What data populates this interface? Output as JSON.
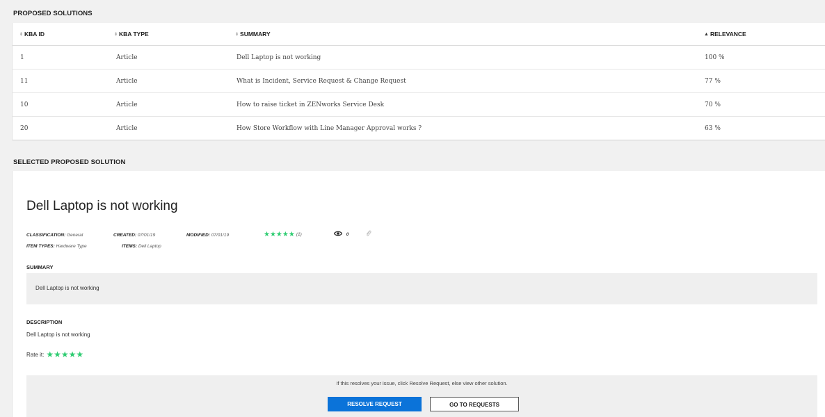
{
  "proposed_solutions": {
    "section_title": "PROPOSED SOLUTIONS",
    "columns": [
      {
        "label": "KBA ID",
        "sort": "none"
      },
      {
        "label": "KBA TYPE",
        "sort": "none"
      },
      {
        "label": "SUMMARY",
        "sort": "none"
      },
      {
        "label": "RELEVANCE",
        "sort": "ascending"
      }
    ],
    "sort_icons": {
      "none": "⇕",
      "ascending": "▲"
    },
    "rows": [
      {
        "id": "1",
        "type": "Article",
        "summary": "Dell Laptop is not working",
        "relevance": "100 %"
      },
      {
        "id": "11",
        "type": "Article",
        "summary": "What is Incident, Service Request & Change Request",
        "relevance": "77 %"
      },
      {
        "id": "10",
        "type": "Article",
        "summary": "How to raise ticket in ZENworks Service Desk",
        "relevance": "70 %"
      },
      {
        "id": "20",
        "type": "Article",
        "summary": "How Store Workflow with Line Manager Approval works ?",
        "relevance": "63 %"
      }
    ]
  },
  "selected_solution": {
    "section_title": "SELECTED PROPOSED SOLUTION",
    "title": "Dell Laptop is not working",
    "meta": {
      "classification_label": "CLASSIFICATION:",
      "classification": "General",
      "created_label": "CREATED:",
      "created": "07/01/19",
      "modified_label": "MODIFIED:",
      "modified": "07/01/19",
      "item_types_label": "ITEM TYPES:",
      "item_types": "Hardware Type",
      "items_label": "ITEMS:",
      "items": "Dell Laptop",
      "stars": "★★★★★",
      "rating_count": "(1)",
      "views": "0",
      "icons": {
        "views": "eye-icon",
        "attachment": "paperclip-icon"
      }
    },
    "summary_label": "SUMMARY",
    "summary_text": "Dell Laptop is not working",
    "description_label": "DESCRIPTION",
    "description_text": "Dell Laptop is not working",
    "rate_label": "Rate it:",
    "rate_stars": "★★★★★",
    "action_message": "If this resolves your issue, click Resolve Request, else view other solution.",
    "resolve_button": "RESOLVE REQUEST",
    "go_button": "GO TO REQUESTS"
  },
  "colors": {
    "primary_button": "#0b73d9",
    "stars": "#2ecc71",
    "panel_bg": "#efefef"
  }
}
